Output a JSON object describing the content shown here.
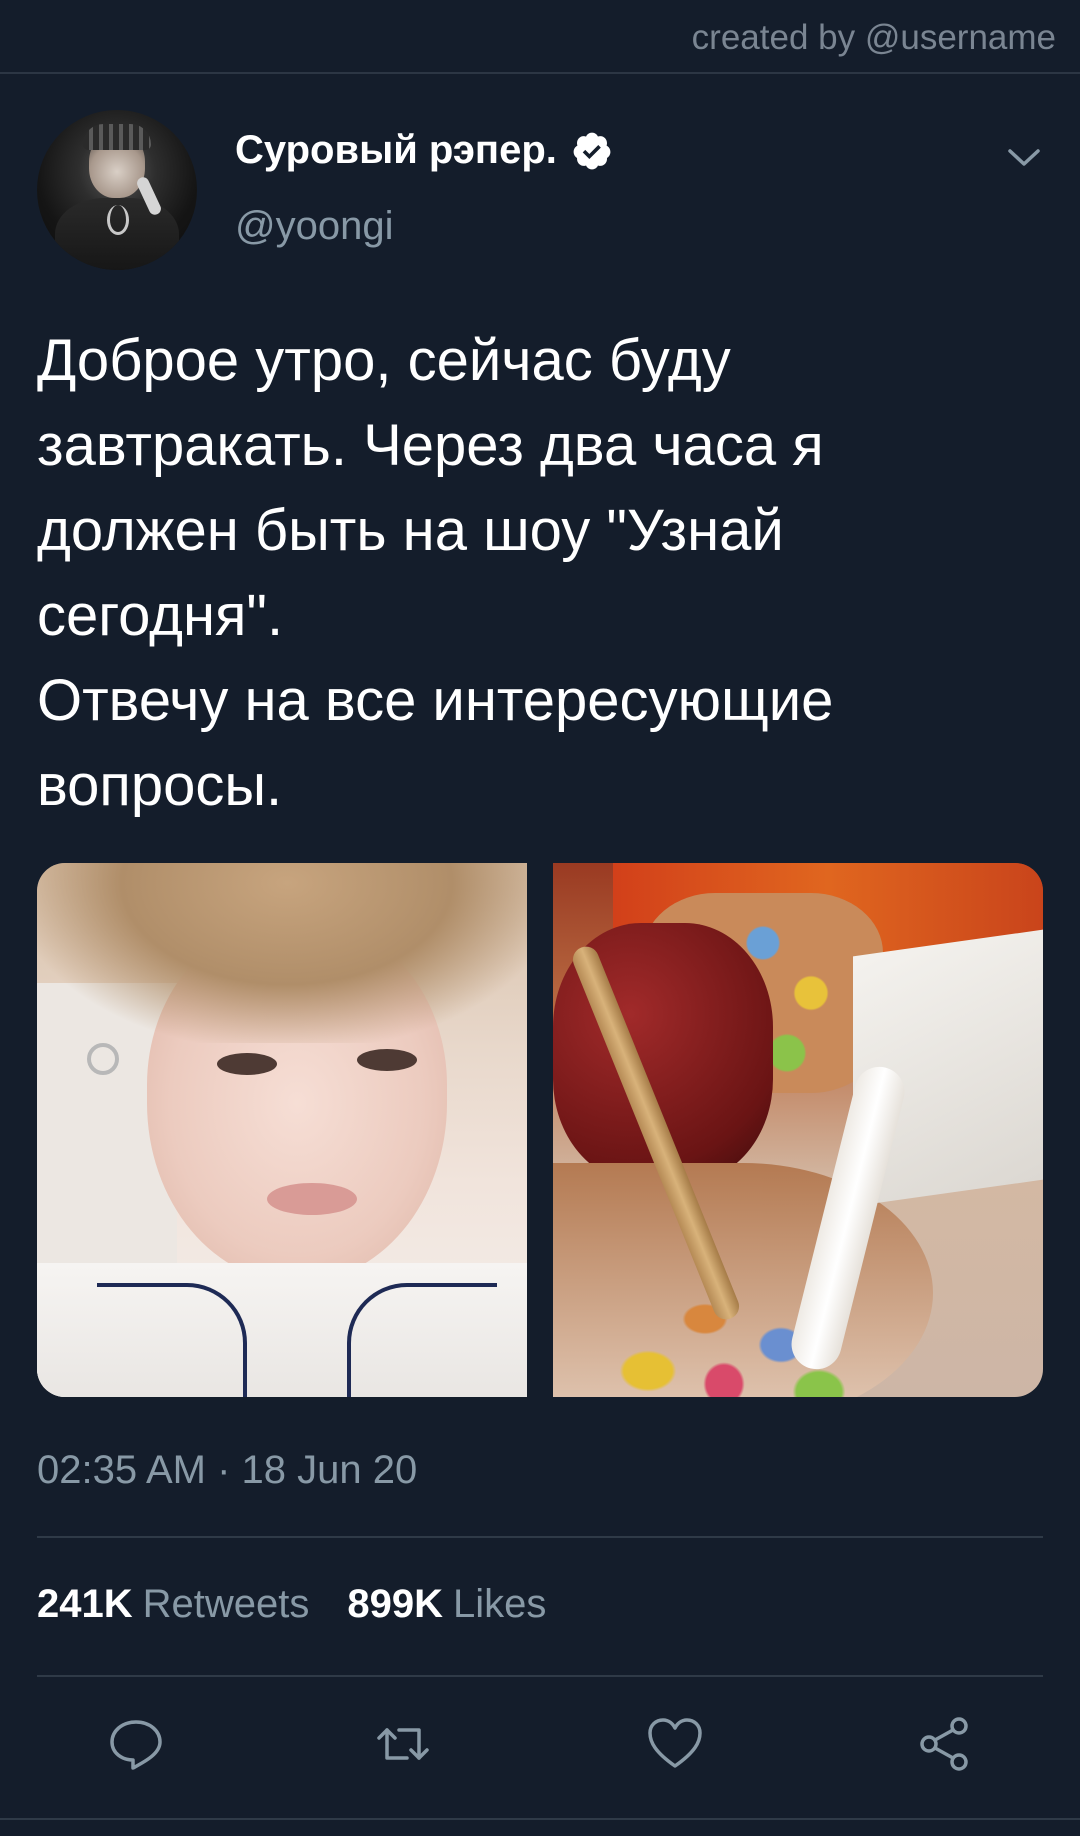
{
  "credit": "created by @username",
  "tweet": {
    "display_name": "Суровый рэпер.",
    "handle": "@yoongi",
    "text": "Доброе утро, сейчас буду\nзавтракать. Через два часа я\nдолжен быть на шоу \"Узнай\nсегодня\".\nОтвечу на все интересующие\nвопросы.",
    "timestamp": "02:35 AM · 18 Jun 20"
  },
  "stats": {
    "retweets_count": "241K",
    "retweets_label": "Retweets",
    "likes_count": "899K",
    "likes_label": "Likes"
  },
  "icons": {
    "verified": "verified-badge-icon",
    "more": "chevron-down-icon",
    "reply": "reply-icon",
    "retweet": "retweet-icon",
    "like": "heart-icon",
    "share": "share-icon"
  },
  "colors": {
    "background": "#141d2b",
    "secondary_text": "#8899a6",
    "divider": "#2f3a47"
  }
}
